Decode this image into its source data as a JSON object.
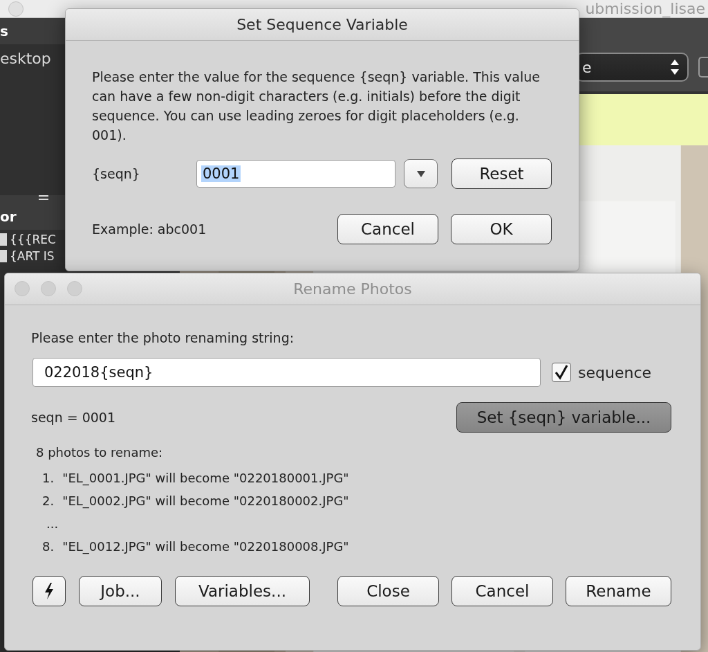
{
  "background_window": {
    "title": "ubmission_lisae",
    "sidebar": {
      "header": "s",
      "items": [
        "esktop"
      ],
      "section": "or",
      "rows": [
        {
          "label": "{{{REC",
          "checked": false
        },
        {
          "label": "{ART IS",
          "checked": false
        }
      ]
    },
    "toolbar": {
      "popup_value": "e"
    }
  },
  "sequence_dialog": {
    "title": "Set Sequence Variable",
    "message": "Please enter the value for the sequence {seqn} variable.  This value can have a few non-digit characters (e.g. initials) before the digit sequence.  You can use leading zeroes for digit placeholders (e.g. 001).",
    "field_label": "{seqn}",
    "field_value": "0001",
    "value_selected": true,
    "reset_button": "Reset",
    "example": "Example: abc001",
    "buttons": [
      "Cancel",
      "OK"
    ]
  },
  "rename_dialog": {
    "title": "Rename Photos",
    "prompt": "Please enter the photo renaming string:",
    "rename_string": "022018{seqn}",
    "sequence_checkbox": {
      "label": "sequence",
      "checked": true
    },
    "seqn_value": "seqn = 0001",
    "set_variable_button": {
      "label": "Set {seqn} variable...",
      "pressed": true
    },
    "count": "8 photos to rename:",
    "list": [
      {
        "kind": "item",
        "number": "1.",
        "text": "\"EL_0001.JPG\" will become \"0220180001.JPG\""
      },
      {
        "kind": "item",
        "number": "2.",
        "text": "\"EL_0002.JPG\" will become \"0220180002.JPG\""
      },
      {
        "kind": "ellipsis",
        "text": "..."
      },
      {
        "kind": "item",
        "number": "8.",
        "text": "\"EL_0012.JPG\" will become \"0220180008.JPG\""
      }
    ],
    "left_buttons": [
      {
        "kind": "icon"
      },
      {
        "kind": "text",
        "label": "Job..."
      },
      {
        "kind": "text",
        "label": "Variables..."
      }
    ],
    "right_buttons": [
      "Close",
      "Cancel",
      "Rename"
    ]
  }
}
